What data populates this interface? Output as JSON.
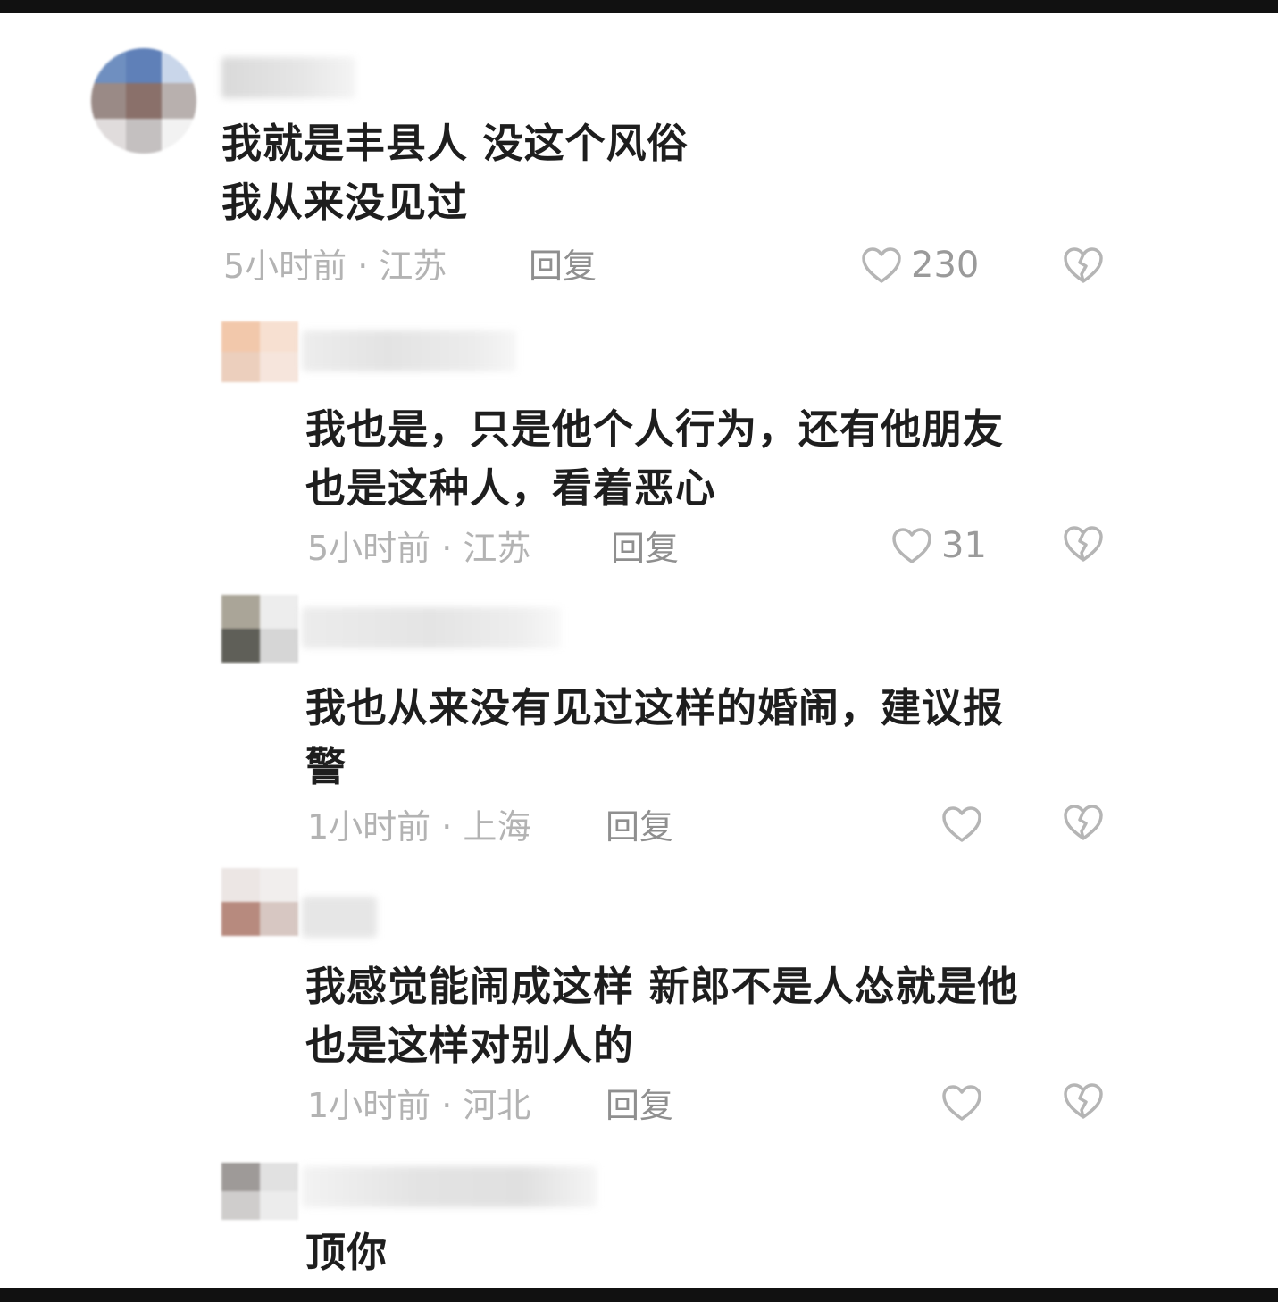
{
  "colors": {
    "background": "#ffffff",
    "frame": "#111111",
    "comment_text": "#1e1e1e",
    "meta_text": "#b3b3b3",
    "reply_text": "#8f8f8f",
    "icon": "#b5b5b5"
  },
  "icons": {
    "like": "heart-outline-icon",
    "dislike": "broken-heart-icon"
  },
  "comments": [
    {
      "text": "我就是丰县人  没这个风俗\n我从来没见过",
      "time_location": "5小时前 · 江苏",
      "reply_label": "回复",
      "like_count": "230"
    },
    {
      "text": "我也是，只是他个人行为，还有他朋友\n也是这种人，看着恶心",
      "time_location": "5小时前 · 江苏",
      "reply_label": "回复",
      "like_count": "31"
    },
    {
      "text": "我也从来没有见过这样的婚闹，建议报\n警",
      "time_location": "1小时前 · 上海",
      "reply_label": "回复",
      "like_count": ""
    },
    {
      "text": "我感觉能闹成这样 新郎不是人怂就是他\n也是这样对别人的",
      "time_location": "1小时前 · 河北",
      "reply_label": "回复",
      "like_count": ""
    },
    {
      "text": "顶你"
    }
  ]
}
